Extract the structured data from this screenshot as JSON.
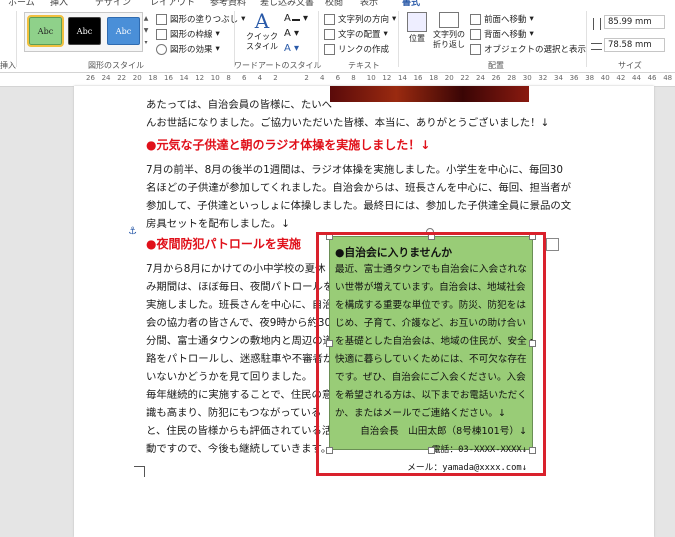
{
  "ribbon": {
    "tabs": [
      "ホーム",
      "挿入",
      "デザイン",
      "レイアウト",
      "参考資料",
      "差し込み文書",
      "校閲",
      "表示",
      "書式"
    ],
    "shape_styles": {
      "preset_labels": [
        "Abc",
        "Abc",
        "Abc"
      ],
      "preset_colors": [
        "#8fd18a",
        "#000000",
        "#4a8fd8"
      ],
      "fill_label": "図形の塗りつぶし",
      "outline_label": "図形の枠線",
      "effects_label": "図形の効果",
      "group_label": "図形のスタイル"
    },
    "wordart": {
      "quick_style_label": "クイック\nスタイル",
      "group_label": "ワードアートのスタイル"
    },
    "text": {
      "direction_label": "文字列の方向",
      "align_label": "文字の配置",
      "link_label": "リンクの作成",
      "group_label": "テキスト"
    },
    "arrange": {
      "position_label": "位置",
      "wrap_label": "文字列の\n折り返し",
      "bring_forward_label": "前面へ移動",
      "send_backward_label": "背面へ移動",
      "selection_pane_label": "オブジェクトの選択と表示",
      "group_label": "配置"
    },
    "size": {
      "height_value": "85.99 mm",
      "width_value": "78.58 mm",
      "group_label": "サイズ"
    },
    "left_partial_label": "挿入"
  },
  "ruler": {
    "ticks": [
      "26",
      "24",
      "22",
      "20",
      "18",
      "16",
      "14",
      "12",
      "10",
      "8",
      "6",
      "4",
      "2",
      "",
      "2",
      "4",
      "6",
      "8",
      "10",
      "12",
      "14",
      "16",
      "18",
      "20",
      "22",
      "24",
      "26",
      "28",
      "30",
      "32",
      "34",
      "36",
      "38",
      "40",
      "42",
      "44",
      "46",
      "48"
    ]
  },
  "document": {
    "intro_lines": [
      "あたっては、自治会員の皆様に、たいへ",
      "んお世話になりました。ご協力いただいた皆様、本当に、ありがとうございました！↓"
    ],
    "heading1": "●元気な子供達と朝のラジオ体操を実施しました！↓",
    "section1_lines": [
      "7月の前半、8月の後半の1週間は、ラジオ体操を実施しました。小学生を中心に、毎回30",
      "名ほどの子供達が参加してくれました。自治会からは、班長さんを中心に、毎回、担当者が",
      "参加して、子供達といっしょに体操しました。最終日には、参加した子供達全員に景品の文",
      "房具セットを配布しました。↓"
    ],
    "heading2": "●夜間防犯パトロールを実施",
    "section2_lines": [
      "7月から8月にかけての小中学校の夏休",
      "み期間は、ほぼ毎日、夜間パトロールを",
      "実施しました。班長さんを中心に、自治",
      "会の協力者の皆さんで、夜9時から約30",
      "分間、富士通タウンの敷地内と周辺の道",
      "路をパトロールし、迷惑駐車や不審者が",
      "いないかどうかを見て回りました。",
      "毎年継続的に実施することで、住民の意",
      "識も高まり、防犯にもつながっている",
      "と、住民の皆様からも評価されている活",
      "動ですので、今後も継続していきます。"
    ]
  },
  "textbox": {
    "title": "●自治会に入りませんか",
    "body_lines": [
      "最近、富士通タウンでも自治会に入会されな",
      "い世帯が増えています。自治会は、地域社会",
      "を構成する重要な単位です。防災、防犯をは",
      "じめ、子育て、介護など、お互いの助け合い",
      "を基礎とした自治会は、地域の住民が、安全・",
      "快適に暮らしていくためには、不可欠な存在",
      "です。ぜひ、自治会にご入会ください。入会",
      "を希望される方は、以下までお電話いただく",
      "か、またはメールでご連絡ください。↓"
    ],
    "contact_name": "自治会長　山田太郎（8号棟101号）↓",
    "contact_phone": "電話：03-XXXX-XXXX↓",
    "contact_email": "メール：yamada@xxxx.com↓",
    "fill_color": "#99cc77",
    "highlight_color": "#d9212c"
  }
}
